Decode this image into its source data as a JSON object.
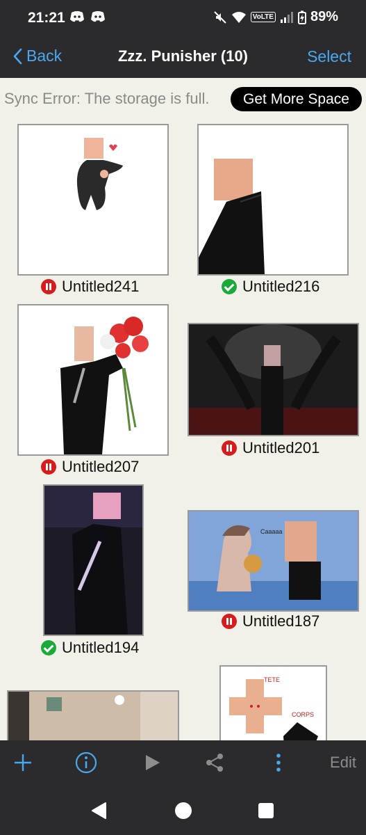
{
  "status_bar": {
    "time": "21:21",
    "battery": "89%",
    "network_badge": "VoLTE"
  },
  "nav": {
    "back_label": "Back",
    "title": "Zzz. Punisher (10)",
    "select_label": "Select"
  },
  "sync": {
    "message": "Sync Error: The storage is full.",
    "button_label": "Get More Space"
  },
  "items": [
    {
      "name": "Untitled241",
      "status": "paused"
    },
    {
      "name": "Untitled216",
      "status": "synced"
    },
    {
      "name": "Untitled207",
      "status": "paused"
    },
    {
      "name": "Untitled201",
      "status": "paused"
    },
    {
      "name": "Untitled194",
      "status": "synced"
    },
    {
      "name": "Untitled187",
      "status": "paused"
    }
  ],
  "thumbnail_texts": {
    "tete": "TETE",
    "corps": "CORPS"
  },
  "toolbar": {
    "edit_label": "Edit"
  },
  "colors": {
    "bar_bg": "#2b2b2d",
    "accent_blue": "#4aa8f0",
    "page_bg": "#f2f1e9",
    "paused_red": "#d81c1c",
    "synced_green": "#1aaa3a"
  }
}
